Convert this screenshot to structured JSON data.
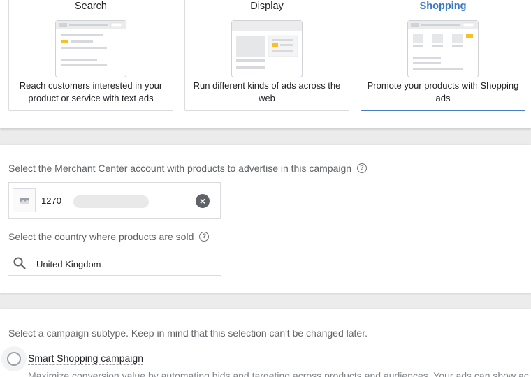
{
  "campaign_types": [
    {
      "title": "Search",
      "description": "Reach customers interested in your product or service with text ads",
      "selected": false
    },
    {
      "title": "Display",
      "description": "Run different kinds of ads across the web",
      "selected": false
    },
    {
      "title": "Shopping",
      "description": "Promote your products with Shopping ads",
      "selected": true
    }
  ],
  "merchant": {
    "label": "Select the Merchant Center account with products to advertise in this campaign",
    "account_id": "1270",
    "clear_icon": "close-circle-icon"
  },
  "country": {
    "label": "Select the country where products are sold",
    "value": "United Kingdom"
  },
  "subtype": {
    "label": "Select a campaign subtype. Keep in mind that this selection can't be changed later.",
    "options": [
      {
        "label": "Smart Shopping campaign",
        "description": "Maximize conversion value by automating bids and targeting across products and audiences. Your ads can show ac"
      }
    ]
  },
  "colors": {
    "accent": "#3b78c4",
    "highlight_yellow": "#f6c026",
    "section_bg": "#ececec"
  }
}
